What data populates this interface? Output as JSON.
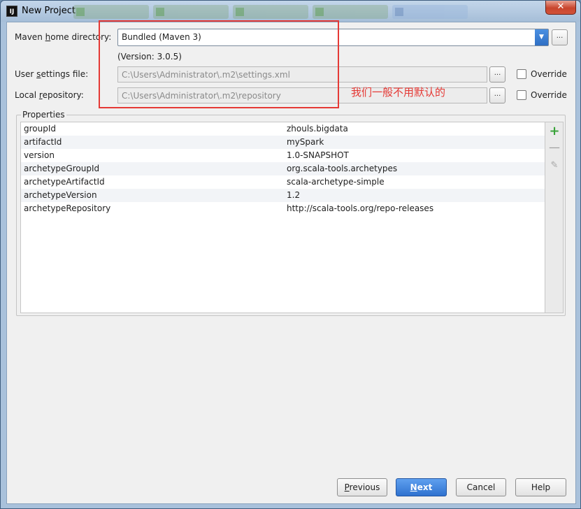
{
  "window": {
    "title": "New Project",
    "app_icon": "IJ",
    "close_glyph": "✕"
  },
  "maven": {
    "home_label_pre": "Maven ",
    "home_label_u": "h",
    "home_label_post": "ome directory:",
    "home_value": "Bundled (Maven 3)",
    "version": "(Version: 3.0.5)",
    "settings_label_pre": "User ",
    "settings_label_u": "s",
    "settings_label_post": "ettings file:",
    "settings_value": "C:\\Users\\Administrator\\.m2\\settings.xml",
    "repo_label_pre": "Local ",
    "repo_label_u": "r",
    "repo_label_post": "epository:",
    "repo_value": "C:\\Users\\Administrator\\.m2\\repository",
    "override_label": "Override",
    "browse_label": "..."
  },
  "annotation": {
    "text": "我们一般不用默认的",
    "color": "#e53935"
  },
  "properties": {
    "title": "Properties",
    "rows": [
      {
        "key": "groupId",
        "value": "zhouls.bigdata"
      },
      {
        "key": "artifactId",
        "value": "mySpark"
      },
      {
        "key": "version",
        "value": "1.0-SNAPSHOT"
      },
      {
        "key": "archetypeGroupId",
        "value": "org.scala-tools.archetypes"
      },
      {
        "key": "archetypeArtifactId",
        "value": "scala-archetype-simple"
      },
      {
        "key": "archetypeVersion",
        "value": "1.2"
      },
      {
        "key": "archetypeRepository",
        "value": "http://scala-tools.org/repo-releases"
      }
    ],
    "add_glyph": "+",
    "remove_glyph": "—",
    "edit_glyph": "✎"
  },
  "buttons": {
    "previous_u": "P",
    "previous_rest": "revious",
    "next_u": "N",
    "next_rest": "ext",
    "cancel": "Cancel",
    "help": "Help"
  },
  "colors": {
    "accent": "#2f71cf",
    "add_green": "#3aa33a"
  }
}
